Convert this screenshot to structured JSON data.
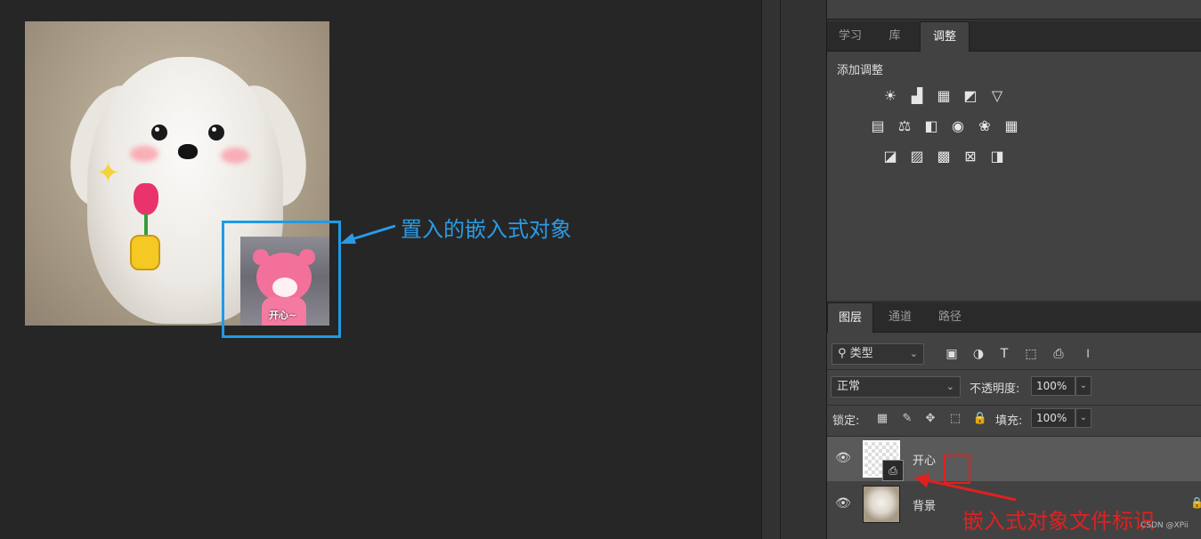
{
  "canvas": {
    "callout_text": "置入的嵌入式对象",
    "placed_object_caption": "开心~"
  },
  "adjustments": {
    "tabs": [
      {
        "label": "学习",
        "active": false
      },
      {
        "label": "库",
        "active": false
      },
      {
        "label": "调整",
        "active": true
      }
    ],
    "title": "添加调整",
    "rows": [
      [
        "brightness-contrast-icon",
        "levels-icon",
        "curves-icon",
        "exposure-icon",
        "vibrance-icon"
      ],
      [
        "hue-saturation-icon",
        "color-balance-icon",
        "black-white-icon",
        "photo-filter-icon",
        "channel-mixer-icon",
        "color-lookup-icon"
      ],
      [
        "invert-icon",
        "posterize-icon",
        "threshold-icon",
        "selective-color-icon",
        "gradient-map-icon"
      ]
    ]
  },
  "layers_panel": {
    "tabs": [
      {
        "label": "图层",
        "active": true
      },
      {
        "label": "通道",
        "active": false
      },
      {
        "label": "路径",
        "active": false
      }
    ],
    "filter_kind": "类型",
    "filter_icons": [
      "pixel-filter-icon",
      "adjustment-filter-icon",
      "type-filter-icon",
      "shape-filter-icon",
      "smart-object-filter-icon",
      "filter-toggle-icon"
    ],
    "blend_mode": "正常",
    "opacity_label": "不透明度:",
    "opacity_value": "100%",
    "lock_label": "锁定:",
    "lock_icons": [
      "lock-transparent-icon",
      "lock-image-icon",
      "lock-position-icon",
      "lock-artboard-icon",
      "lock-all-icon"
    ],
    "fill_label": "填充:",
    "fill_value": "100%",
    "layers": [
      {
        "name": "开心",
        "selected": true,
        "visible": true,
        "smart_object": true
      },
      {
        "name": "背景",
        "selected": false,
        "visible": true,
        "locked": true
      }
    ]
  },
  "annotations": {
    "smart_object_callout": "嵌入式对象文件标识",
    "watermark": "CSDN @XPii"
  },
  "colors": {
    "callout_blue": "#2b9be6",
    "callout_red": "#e02020",
    "panel_bg": "#424242"
  }
}
